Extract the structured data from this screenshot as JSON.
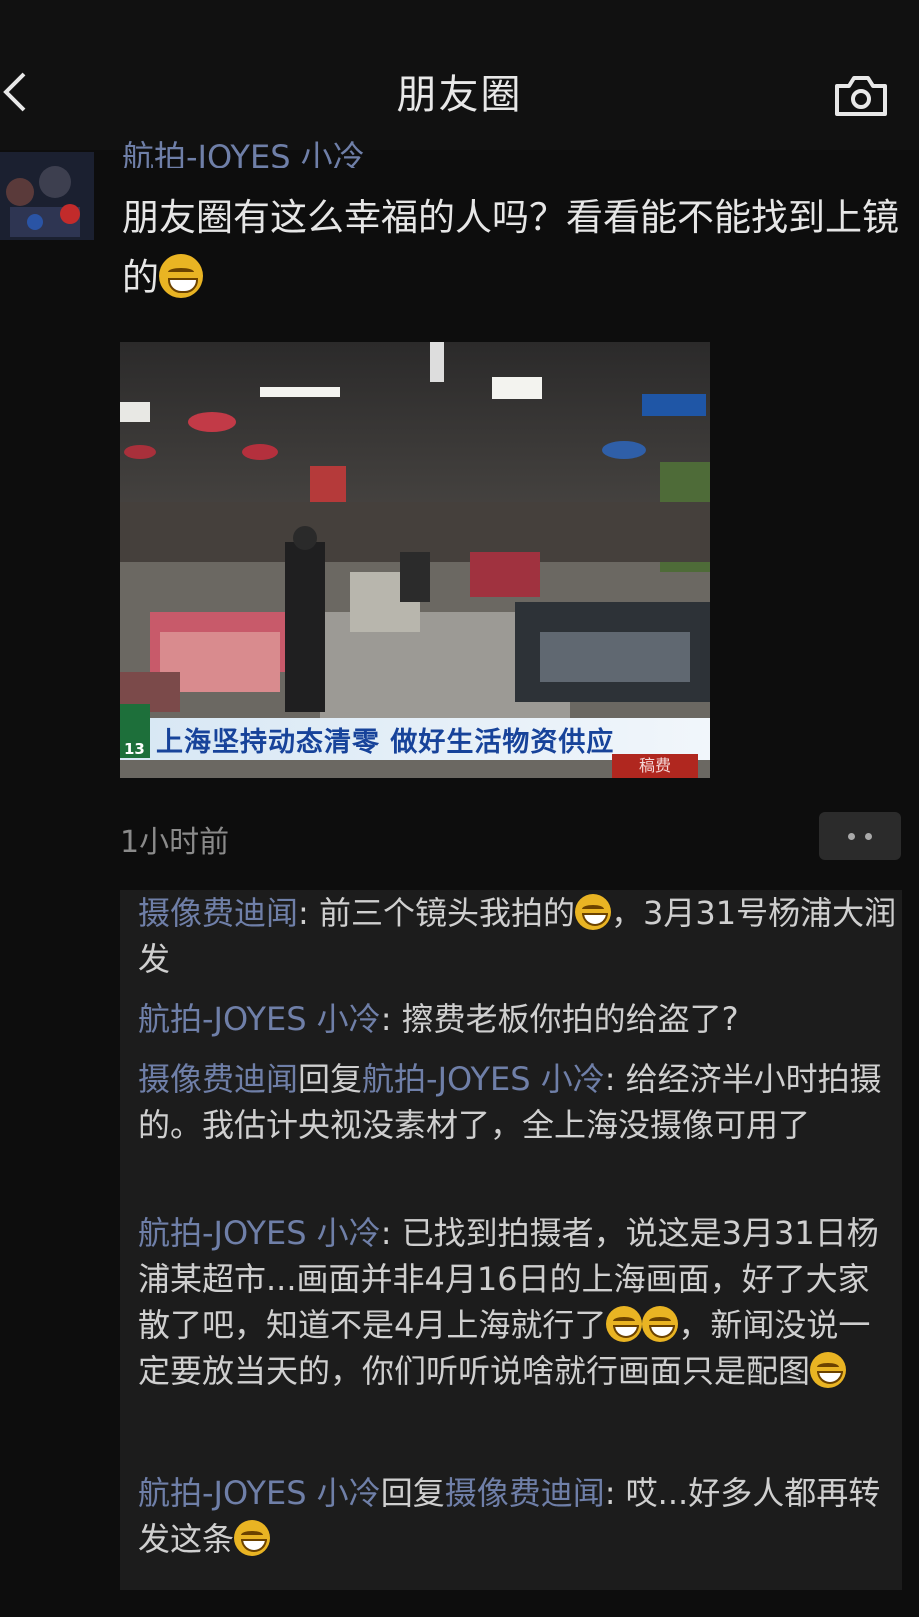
{
  "header": {
    "title": "朋友圈",
    "back_icon": "chevron-left-icon",
    "camera_icon": "camera-icon"
  },
  "post": {
    "author": "航拍-JOYES 小冷",
    "text": "朋友圈有这么幸福的人吗？看看能不能找到上镜的",
    "image": {
      "channel": "13",
      "caption": "上海坚持动态清零 做好生活物资供应",
      "tag": "稿费"
    },
    "time": "1小时前"
  },
  "comments": [
    {
      "name": "摄像费迪闻",
      "text": ": 前三个镜头我拍的",
      "text2": "，3月31号杨浦大润发"
    },
    {
      "name": "航拍-JOYES 小冷",
      "text": ": 擦费老板你拍的给盗了?"
    },
    {
      "name": "摄像费迪闻",
      "reply": "回复",
      "name2": "航拍-JOYES 小冷",
      "text": ": 给经济半小时拍摄的。我估计央视没素材了，全上海没摄像可用了"
    },
    {
      "name": "航拍-JOYES 小冷",
      "text": ": 已找到拍摄者，说这是3月31日杨浦某超市...画面并非4月16日的上海画面，好了大家散了吧，知道不是4月上海就行了",
      "text2": "，新闻没说一定要放当天的，你们听听说啥就行画面只是配图"
    },
    {
      "name": "航拍-JOYES 小冷",
      "reply": "回复",
      "name2": "摄像费迪闻",
      "text": ": 哎...好多人都再转发这条"
    }
  ]
}
